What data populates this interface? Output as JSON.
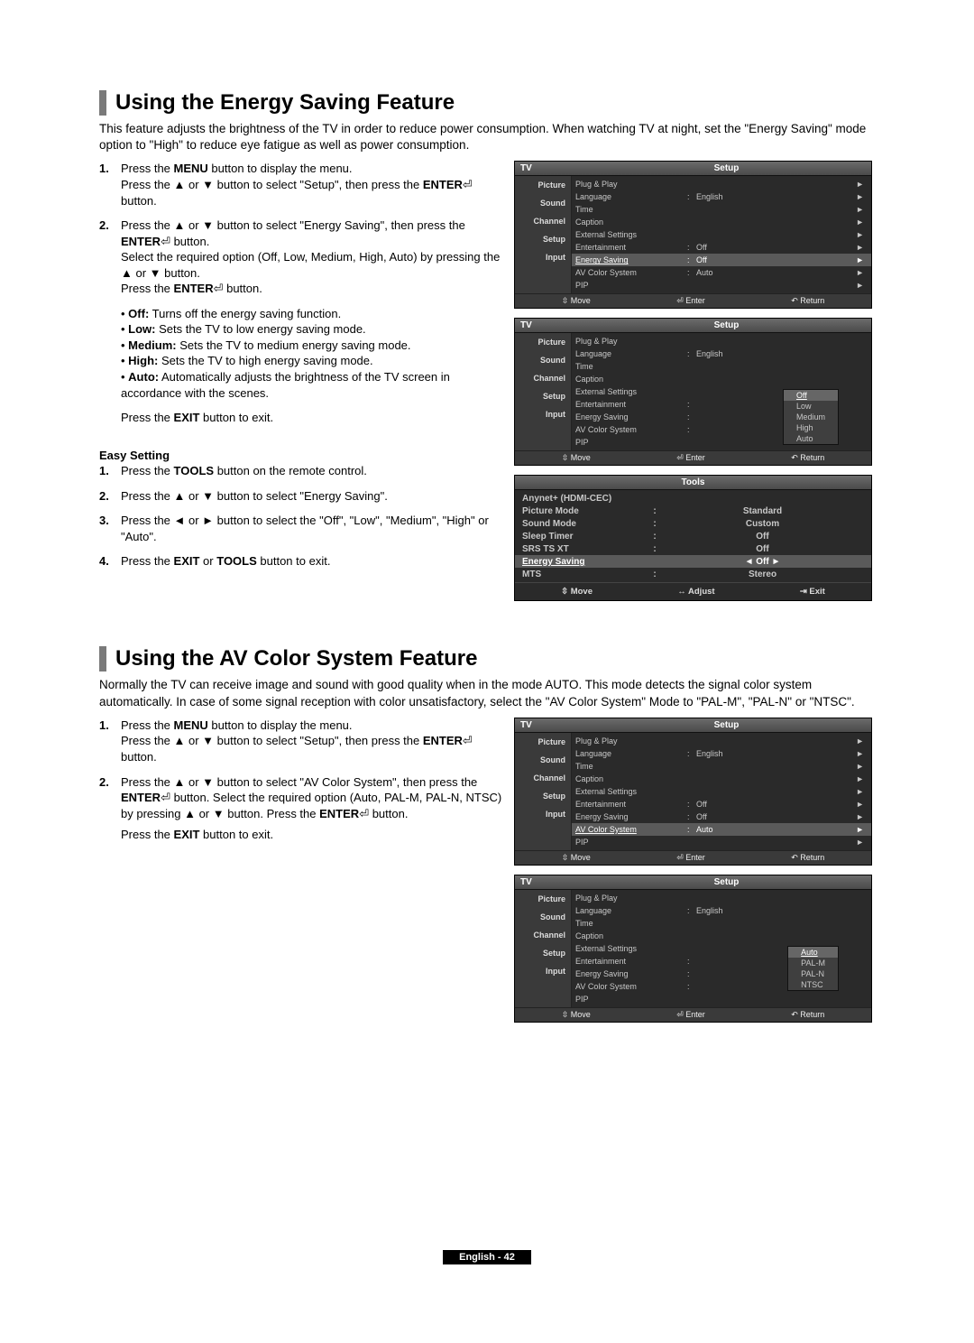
{
  "section1": {
    "title": "Using the Energy Saving Feature",
    "desc": "This feature adjusts the brightness of the TV in order to reduce power consumption. When watching TV at night, set the \"Energy Saving\" mode option to \"High\" to reduce eye fatigue as well as power consumption.",
    "step1_a": "Press the ",
    "step1_b": "MENU",
    "step1_c": " button to display the menu.",
    "step1_d": "Press the ▲ or ▼ button to select \"Setup\", then press the ",
    "step1_e": "ENTER",
    "step1_f": "⏎ button.",
    "step2_a": "Press the ▲ or ▼ button to select \"Energy Saving\", then press the ",
    "step2_b": "ENTER",
    "step2_c": "⏎ button.",
    "step2_d": "Select the required option (Off, Low, Medium, High, Auto) by pressing the ▲ or ▼ button.",
    "step2_e": "Press the ",
    "step2_f": "ENTER",
    "step2_g": "⏎ button.",
    "bullets": [
      {
        "b": "Off:",
        "t": " Turns off the energy saving function."
      },
      {
        "b": "Low:",
        "t": " Sets the TV to low energy saving mode."
      },
      {
        "b": "Medium:",
        "t": " Sets the TV to medium energy saving mode."
      },
      {
        "b": "High:",
        "t": " Sets the TV to high energy saving mode."
      },
      {
        "b": "Auto:",
        "t": " Automatically adjusts the brightness of the TV screen in accordance with the scenes."
      }
    ],
    "exit_a": "Press the ",
    "exit_b": "EXIT",
    "exit_c": " button to exit.",
    "easy_title": "Easy Setting",
    "easy": [
      {
        "n": "1.",
        "pre": "Press the ",
        "b": "TOOLS",
        "post": " button on the remote control."
      },
      {
        "n": "2.",
        "pre": "Press the ▲ or ▼ button to select \"Energy Saving\".",
        "b": "",
        "post": ""
      },
      {
        "n": "3.",
        "pre": "Press the ◄ or ► button to select the \"Off\", \"Low\", \"Medium\", \"High\" or \"Auto\".",
        "b": "",
        "post": ""
      },
      {
        "n": "4.",
        "pre": "Press the ",
        "b": "EXIT",
        "mid": " or ",
        "b2": "TOOLS",
        "post": " button to exit."
      }
    ]
  },
  "osd": {
    "tv": "TV",
    "title": "Setup",
    "tabs": [
      "Picture",
      "Sound",
      "Channel",
      "Setup",
      "Input"
    ],
    "rows1": [
      {
        "label": "Plug & Play",
        "val": "",
        "arrow": "►"
      },
      {
        "label": "Language",
        "colon": ":",
        "val": "English",
        "arrow": "►"
      },
      {
        "label": "Time",
        "val": "",
        "arrow": "►"
      },
      {
        "label": "Caption",
        "val": "",
        "arrow": "►"
      },
      {
        "label": "External Settings",
        "val": "",
        "arrow": "►"
      },
      {
        "label": "Entertainment",
        "colon": ":",
        "val": "Off",
        "arrow": "►"
      },
      {
        "label": "Energy Saving",
        "colon": ":",
        "val": "Off",
        "arrow": "►",
        "hl": true
      },
      {
        "label": "AV Color System",
        "colon": ":",
        "val": "Auto",
        "arrow": "►"
      },
      {
        "label": "PIP",
        "val": "",
        "arrow": "►"
      }
    ],
    "footer": {
      "move": "⇳ Move",
      "enter": "⏎ Enter",
      "return": "↶ Return"
    },
    "popup_es": [
      "Off",
      "Low",
      "Medium",
      "High",
      "Auto"
    ],
    "popup_es_sel": "Off",
    "rows2": [
      {
        "label": "Plug & Play",
        "val": ""
      },
      {
        "label": "Language",
        "colon": ":",
        "val": "English"
      },
      {
        "label": "Time",
        "val": ""
      },
      {
        "label": "Caption",
        "val": ""
      },
      {
        "label": "External Settings",
        "val": ""
      },
      {
        "label": "Entertainment",
        "colon": ":",
        "val": ""
      },
      {
        "label": "Energy Saving",
        "colon": ":",
        "val": ""
      },
      {
        "label": "AV Color System",
        "colon": ":",
        "val": ""
      },
      {
        "label": "PIP",
        "val": ""
      }
    ]
  },
  "tools": {
    "title": "Tools",
    "rows": [
      {
        "l": "Anynet+ (HDMI-CEC)",
        "v": ""
      },
      {
        "l": "Picture Mode",
        "c": ":",
        "v": "Standard"
      },
      {
        "l": "Sound Mode",
        "c": ":",
        "v": "Custom"
      },
      {
        "l": "Sleep Timer",
        "c": ":",
        "v": "Off"
      },
      {
        "l": "SRS TS XT",
        "c": ":",
        "v": "Off"
      },
      {
        "l": "Energy Saving",
        "c": "",
        "v": "◄        Off        ►",
        "hl": true
      },
      {
        "l": "MTS",
        "c": ":",
        "v": "Stereo"
      }
    ],
    "footer": {
      "move": "⇳ Move",
      "adjust": "↔ Adjust",
      "exit": "⇥ Exit"
    }
  },
  "section2": {
    "title": "Using the AV Color System Feature",
    "desc": "Normally the TV can receive image and sound with good quality when in the mode AUTO. This mode detects the signal color system automatically. In case of some signal reception with color unsatisfactory, select the \"AV Color System\" Mode to \"PAL-M\", \"PAL-N\" or \"NTSC\".",
    "step1_a": "Press the ",
    "step1_b": "MENU",
    "step1_c": " button to display the menu.",
    "step1_d": "Press the ▲ or ▼ button to select \"Setup\", then press the ",
    "step1_e": "ENTER",
    "step1_f": "⏎ button.",
    "step2_a": "Press the ▲ or ▼ button to select \"AV Color System\", then press the ",
    "step2_b": "ENTER",
    "step2_c": "⏎ button. Select the required option (Auto, PAL-M, PAL-N, NTSC) by pressing ▲ or ▼ button. Press the ",
    "step2_d": "ENTER",
    "step2_e": "⏎ button.",
    "exit_a": "Press the ",
    "exit_b": "EXIT",
    "exit_c": " button to exit."
  },
  "osd2": {
    "rows3_hl": "AV Color System",
    "popup_av": [
      "Auto",
      "PAL-M",
      "PAL-N",
      "NTSC"
    ],
    "popup_av_sel": "Auto"
  },
  "footer": "English - 42"
}
